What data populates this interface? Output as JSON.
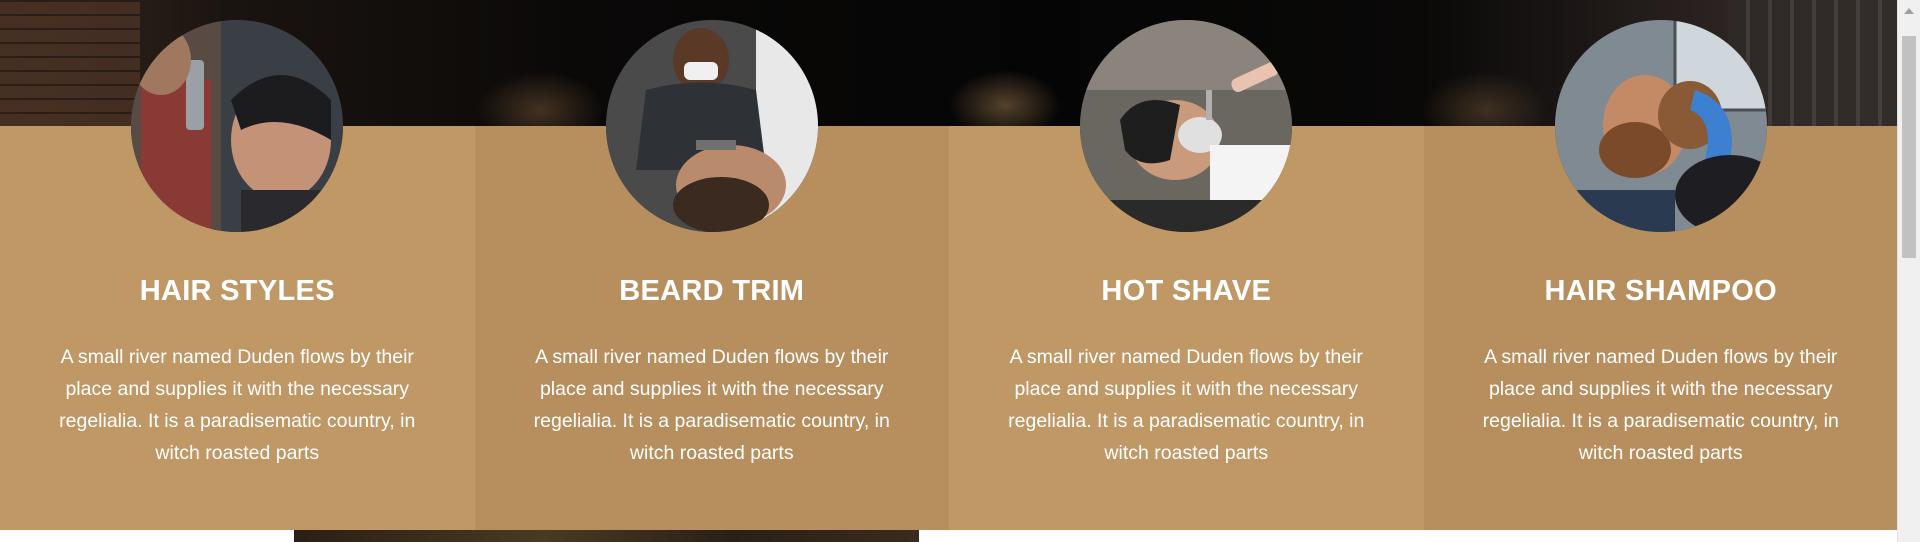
{
  "services": [
    {
      "title": "HAIR STYLES",
      "description": "A small river named Duden flows by their place and supplies it with the necessary regelialia. It is a paradisematic country, in witch roasted parts",
      "image": "barber-spraying-hair-photo"
    },
    {
      "title": "BEARD TRIM",
      "description": "A small river named Duden flows by their place and supplies it with the necessary regelialia. It is a paradisematic country, in witch roasted parts",
      "image": "barber-trimming-beard-photo"
    },
    {
      "title": "HOT SHAVE",
      "description": "A small river named Duden flows by their place and supplies it with the necessary regelialia. It is a paradisematic country, in witch roasted parts",
      "image": "man-receiving-razor-shave-photo"
    },
    {
      "title": "HAIR SHAMPOO",
      "description": "A small river named Duden flows by their place and supplies it with the necessary regelialia. It is a paradisematic country, in witch roasted parts",
      "image": "man-getting-hair-washed-photo"
    }
  ],
  "colors": {
    "card_primary": "#bf9866",
    "card_alternate": "#b78f5e",
    "text": "#ffffff",
    "hero_dark": "#050505"
  }
}
